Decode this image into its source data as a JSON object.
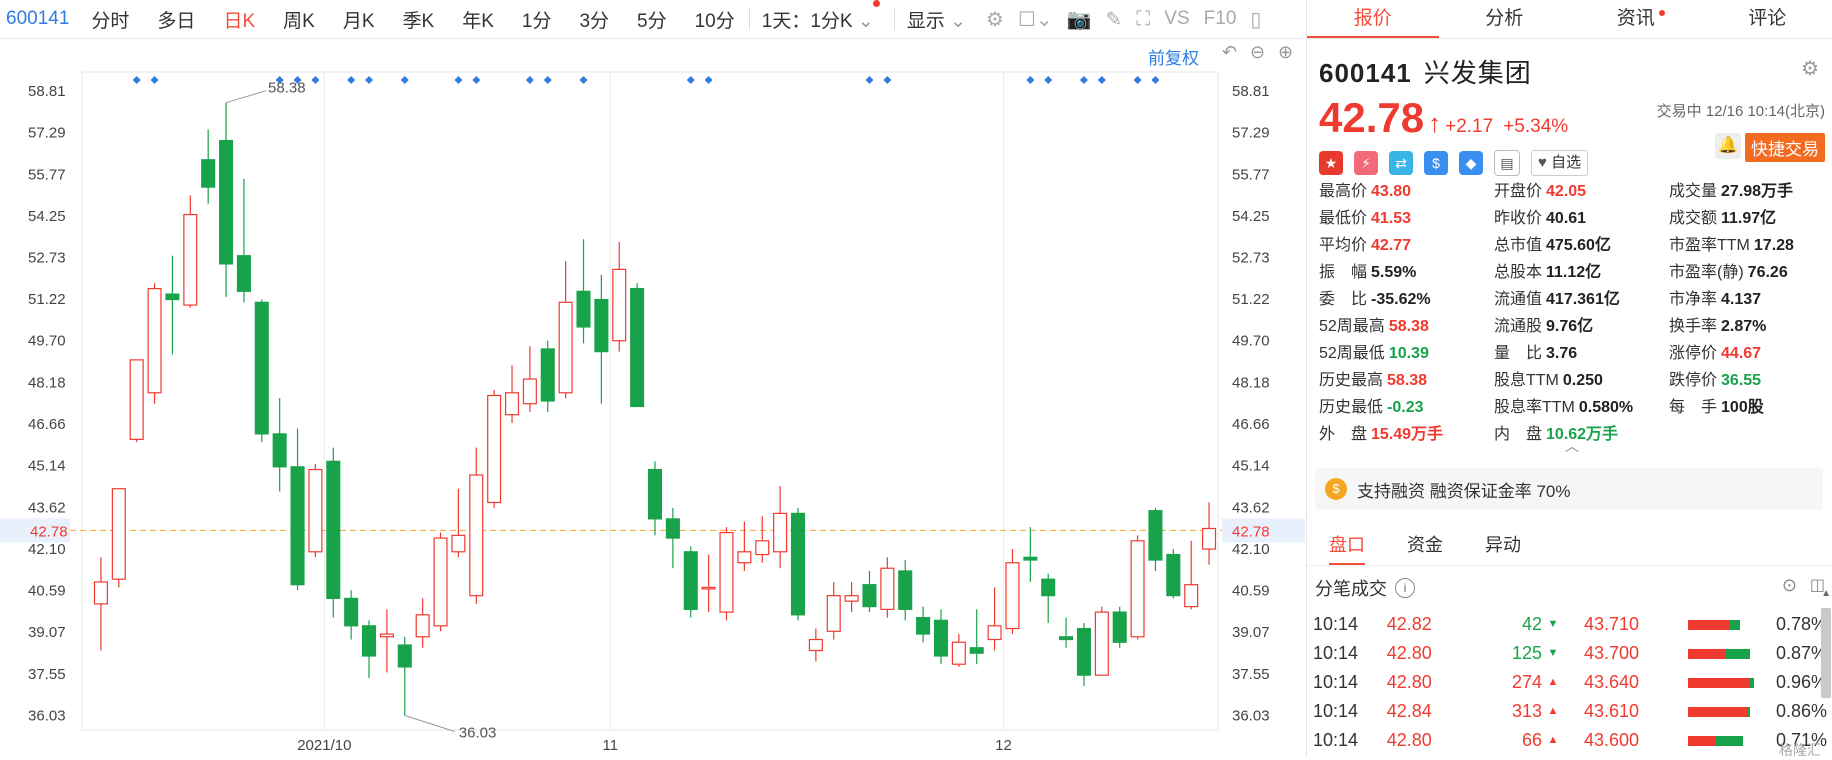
{
  "topbar": {
    "code": "600141",
    "tabs": [
      "分时",
      "多日",
      "日K",
      "周K",
      "月K",
      "季K",
      "年K",
      "1分",
      "3分",
      "5分",
      "10分"
    ],
    "active_tab": "日K",
    "period_select": "1天：1分K",
    "display_select": "显示"
  },
  "chart": {
    "restore_label": "前复权",
    "y_ticks": [
      "58.81",
      "57.29",
      "55.77",
      "54.25",
      "52.73",
      "51.22",
      "49.70",
      "48.18",
      "46.66",
      "45.14",
      "43.62",
      "42.10",
      "40.59",
      "39.07",
      "37.55",
      "36.03"
    ],
    "current_price_label": "42.78",
    "x_labels": [
      {
        "label": "2021/10",
        "i": 13
      },
      {
        "label": "11",
        "i": 29
      },
      {
        "label": "12",
        "i": 51
      }
    ],
    "high_annotation": "58.38",
    "low_annotation": "36.03",
    "colors": {
      "up": "#f03a2f",
      "down": "#18a24a",
      "current_line": "#f5a623",
      "marker": "#2e7de1"
    }
  },
  "chart_data": {
    "type": "candlestick",
    "title": "",
    "ylim": [
      35.5,
      59.5
    ],
    "current_price": 42.78,
    "candles": [
      {
        "o": 40.1,
        "c": 40.9,
        "h": 41.8,
        "l": 38.4
      },
      {
        "o": 41.0,
        "c": 44.3,
        "h": 44.3,
        "l": 40.7
      },
      {
        "o": 46.1,
        "c": 49.0,
        "h": 49.0,
        "l": 46.0
      },
      {
        "o": 47.8,
        "c": 51.6,
        "h": 51.8,
        "l": 47.4
      },
      {
        "o": 51.4,
        "c": 51.2,
        "h": 52.8,
        "l": 49.2
      },
      {
        "o": 51.0,
        "c": 54.3,
        "h": 55.0,
        "l": 50.9
      },
      {
        "o": 56.3,
        "c": 55.3,
        "h": 57.4,
        "l": 54.7
      },
      {
        "o": 57.0,
        "c": 52.5,
        "h": 58.38,
        "l": 51.3
      },
      {
        "o": 52.8,
        "c": 51.5,
        "h": 55.6,
        "l": 51.1
      },
      {
        "o": 51.1,
        "c": 46.3,
        "h": 51.2,
        "l": 46.0
      },
      {
        "o": 46.3,
        "c": 45.1,
        "h": 47.6,
        "l": 44.2
      },
      {
        "o": 45.1,
        "c": 40.8,
        "h": 46.5,
        "l": 40.6
      },
      {
        "o": 42.0,
        "c": 45.0,
        "h": 45.2,
        "l": 41.8
      },
      {
        "o": 45.3,
        "c": 40.3,
        "h": 45.8,
        "l": 39.6
      },
      {
        "o": 40.3,
        "c": 39.3,
        "h": 40.6,
        "l": 38.8
      },
      {
        "o": 39.3,
        "c": 38.2,
        "h": 39.5,
        "l": 37.4
      },
      {
        "o": 38.9,
        "c": 39.0,
        "h": 39.9,
        "l": 37.6
      },
      {
        "o": 38.6,
        "c": 37.8,
        "h": 38.9,
        "l": 36.03
      },
      {
        "o": 38.9,
        "c": 39.7,
        "h": 40.3,
        "l": 38.5
      },
      {
        "o": 39.3,
        "c": 42.5,
        "h": 42.7,
        "l": 39.1
      },
      {
        "o": 42.0,
        "c": 42.6,
        "h": 44.3,
        "l": 41.8
      },
      {
        "o": 40.4,
        "c": 44.8,
        "h": 45.8,
        "l": 40.1
      },
      {
        "o": 43.8,
        "c": 47.7,
        "h": 47.9,
        "l": 43.6
      },
      {
        "o": 47.0,
        "c": 47.8,
        "h": 48.8,
        "l": 46.7
      },
      {
        "o": 47.4,
        "c": 48.3,
        "h": 49.5,
        "l": 47.1
      },
      {
        "o": 49.4,
        "c": 47.5,
        "h": 49.7,
        "l": 47.1
      },
      {
        "o": 47.8,
        "c": 51.1,
        "h": 52.6,
        "l": 47.6
      },
      {
        "o": 51.5,
        "c": 50.2,
        "h": 53.4,
        "l": 49.6
      },
      {
        "o": 51.2,
        "c": 49.3,
        "h": 52.1,
        "l": 47.4
      },
      {
        "o": 49.7,
        "c": 52.3,
        "h": 53.3,
        "l": 49.3
      },
      {
        "o": 51.6,
        "c": 47.3,
        "h": 51.8,
        "l": 47.3
      },
      {
        "o": 45.0,
        "c": 43.2,
        "h": 45.3,
        "l": 42.6
      },
      {
        "o": 43.2,
        "c": 42.5,
        "h": 43.6,
        "l": 41.4
      },
      {
        "o": 42.0,
        "c": 39.9,
        "h": 42.2,
        "l": 39.6
      },
      {
        "o": 40.7,
        "c": 40.7,
        "h": 41.9,
        "l": 39.8
      },
      {
        "o": 39.8,
        "c": 42.7,
        "h": 42.9,
        "l": 39.5
      },
      {
        "o": 41.6,
        "c": 42.0,
        "h": 43.1,
        "l": 41.3
      },
      {
        "o": 41.9,
        "c": 42.4,
        "h": 43.3,
        "l": 41.6
      },
      {
        "o": 42.0,
        "c": 43.4,
        "h": 44.4,
        "l": 41.4
      },
      {
        "o": 43.4,
        "c": 39.7,
        "h": 43.6,
        "l": 39.5
      },
      {
        "o": 38.4,
        "c": 38.8,
        "h": 39.2,
        "l": 38.0
      },
      {
        "o": 39.1,
        "c": 40.4,
        "h": 40.9,
        "l": 38.8
      },
      {
        "o": 40.2,
        "c": 40.4,
        "h": 40.9,
        "l": 39.8
      },
      {
        "o": 40.8,
        "c": 40.0,
        "h": 41.3,
        "l": 39.8
      },
      {
        "o": 39.9,
        "c": 41.4,
        "h": 41.8,
        "l": 39.6
      },
      {
        "o": 41.3,
        "c": 39.9,
        "h": 41.7,
        "l": 39.5
      },
      {
        "o": 39.6,
        "c": 39.0,
        "h": 40.0,
        "l": 38.7
      },
      {
        "o": 39.5,
        "c": 38.2,
        "h": 39.9,
        "l": 37.9
      },
      {
        "o": 37.9,
        "c": 38.7,
        "h": 39.0,
        "l": 37.8
      },
      {
        "o": 38.5,
        "c": 38.3,
        "h": 39.9,
        "l": 37.9
      },
      {
        "o": 38.8,
        "c": 39.3,
        "h": 40.7,
        "l": 38.4
      },
      {
        "o": 39.2,
        "c": 41.6,
        "h": 42.1,
        "l": 39.0
      },
      {
        "o": 41.8,
        "c": 41.7,
        "h": 42.9,
        "l": 40.9
      },
      {
        "o": 41.0,
        "c": 40.4,
        "h": 41.2,
        "l": 39.4
      },
      {
        "o": 38.9,
        "c": 38.8,
        "h": 39.6,
        "l": 38.5
      },
      {
        "o": 39.2,
        "c": 37.5,
        "h": 39.4,
        "l": 37.1
      },
      {
        "o": 37.5,
        "c": 39.8,
        "h": 40.0,
        "l": 37.5
      },
      {
        "o": 39.8,
        "c": 38.7,
        "h": 40.0,
        "l": 38.5
      },
      {
        "o": 38.9,
        "c": 42.4,
        "h": 42.6,
        "l": 38.8
      },
      {
        "o": 43.5,
        "c": 41.7,
        "h": 43.6,
        "l": 41.3
      },
      {
        "o": 41.9,
        "c": 40.4,
        "h": 42.1,
        "l": 40.3
      },
      {
        "o": 40.0,
        "c": 40.8,
        "h": 42.4,
        "l": 39.9
      },
      {
        "o": 42.1,
        "c": 42.85,
        "h": 43.8,
        "l": 41.53
      }
    ],
    "marker_x": [
      2,
      3,
      10,
      11,
      12,
      14,
      15,
      17,
      20,
      21,
      24,
      25,
      27,
      33,
      34,
      43,
      44,
      52,
      53,
      55,
      56,
      58,
      59
    ]
  },
  "stock": {
    "code": "600141",
    "name": "兴发集团",
    "price": "42.78",
    "arrow": "↑",
    "change": "+2.17",
    "change_pct": "+5.34%",
    "status": "交易中 12/16 10:14(北京)",
    "zixuan_label": "自选",
    "quick_trade_label": "快捷交易"
  },
  "right_tabs": [
    "报价",
    "分析",
    "资讯",
    "评论"
  ],
  "stats": [
    [
      {
        "label": "最高价",
        "value": "43.80",
        "color": "red"
      },
      {
        "label": "开盘价",
        "value": "42.05",
        "color": "red"
      },
      {
        "label": "成交量",
        "value": "27.98万手",
        "color": "dark"
      }
    ],
    [
      {
        "label": "最低价",
        "value": "41.53",
        "color": "red"
      },
      {
        "label": "昨收价",
        "value": "40.61",
        "color": "dark"
      },
      {
        "label": "成交额",
        "value": "11.97亿",
        "color": "dark"
      }
    ],
    [
      {
        "label": "平均价",
        "value": "42.77",
        "color": "red"
      },
      {
        "label": "总市值",
        "value": "475.60亿",
        "color": "dark"
      },
      {
        "label": "市盈率TTM",
        "value": "17.28",
        "color": "dark"
      }
    ],
    [
      {
        "label": "振　幅",
        "value": "5.59%",
        "color": "dark"
      },
      {
        "label": "总股本",
        "value": "11.12亿",
        "color": "dark"
      },
      {
        "label": "市盈率(静)",
        "value": "76.26",
        "color": "dark"
      }
    ],
    [
      {
        "label": "委　比",
        "value": "-35.62%",
        "color": "dark"
      },
      {
        "label": "流通值",
        "value": "417.361亿",
        "color": "dark"
      },
      {
        "label": "市净率",
        "value": "4.137",
        "color": "dark"
      }
    ],
    [
      {
        "label": "52周最高",
        "value": "58.38",
        "color": "red"
      },
      {
        "label": "流通股",
        "value": "9.76亿",
        "color": "dark"
      },
      {
        "label": "换手率",
        "value": "2.87%",
        "color": "dark"
      }
    ],
    [
      {
        "label": "52周最低",
        "value": "10.39",
        "color": "green"
      },
      {
        "label": "量　比",
        "value": "3.76",
        "color": "dark"
      },
      {
        "label": "涨停价",
        "value": "44.67",
        "color": "red"
      }
    ],
    [
      {
        "label": "历史最高",
        "value": "58.38",
        "color": "red"
      },
      {
        "label": "股息TTM",
        "value": "0.250",
        "color": "dark"
      },
      {
        "label": "跌停价",
        "value": "36.55",
        "color": "green"
      }
    ],
    [
      {
        "label": "历史最低",
        "value": "-0.23",
        "color": "green"
      },
      {
        "label": "股息率TTM",
        "value": "0.580%",
        "color": "dark"
      },
      {
        "label": "每　手",
        "value": "100股",
        "color": "dark"
      }
    ],
    [
      {
        "label": "外　盘",
        "value": "15.49万手",
        "color": "red"
      },
      {
        "label": "内　盘",
        "value": "10.62万手",
        "color": "green"
      },
      {
        "label": "",
        "value": "",
        "color": "dark"
      }
    ]
  ],
  "margin_text": "支持融资 融资保证金率 70%",
  "sub_tabs": [
    "盘口",
    "资金",
    "异动"
  ],
  "fenbi_title": "分笔成交",
  "fenbi_rows": [
    {
      "time": "10:14",
      "price": "42.82",
      "vol": "42",
      "dir": "down",
      "p2": "43.710",
      "bar_red": 0.6,
      "bar_green": 0.15,
      "pct": "0.78%"
    },
    {
      "time": "10:14",
      "price": "42.80",
      "vol": "125",
      "dir": "down",
      "p2": "43.700",
      "bar_red": 0.55,
      "bar_green": 0.35,
      "pct": "0.87%"
    },
    {
      "time": "10:14",
      "price": "42.80",
      "vol": "274",
      "dir": "up",
      "p2": "43.640",
      "bar_red": 0.9,
      "bar_green": 0.05,
      "pct": "0.96%"
    },
    {
      "time": "10:14",
      "price": "42.84",
      "vol": "313",
      "dir": "up",
      "p2": "43.610",
      "bar_red": 0.85,
      "bar_green": 0.05,
      "pct": "0.86%"
    },
    {
      "time": "10:14",
      "price": "42.80",
      "vol": "66",
      "dir": "up",
      "p2": "43.600",
      "bar_red": 0.4,
      "bar_green": 0.4,
      "pct": "0.71%"
    }
  ],
  "watermark": "格隆汇"
}
